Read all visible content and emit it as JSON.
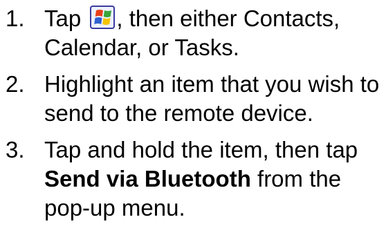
{
  "steps": [
    {
      "number": "1.",
      "line1_before": "Tap ",
      "icon": "windows-start-icon",
      "line1_after": ", then either Contacts,",
      "line2": "Calendar, or Tasks."
    },
    {
      "number": "2.",
      "line1": "Highlight an item that you wish to",
      "line2": "send to the remote device."
    },
    {
      "number": "3.",
      "line1": "Tap and hold the item, then tap",
      "line2_bold": "Send via Bluetooth",
      "line2_after": " from the",
      "line3": "pop-up menu."
    }
  ],
  "colors": {
    "text": "#000000",
    "icon_red": "#e8401c",
    "icon_green": "#3aa53a",
    "icon_blue": "#2f5fd0",
    "icon_yellow": "#f5c400",
    "icon_frame": "#3a3aa0"
  }
}
